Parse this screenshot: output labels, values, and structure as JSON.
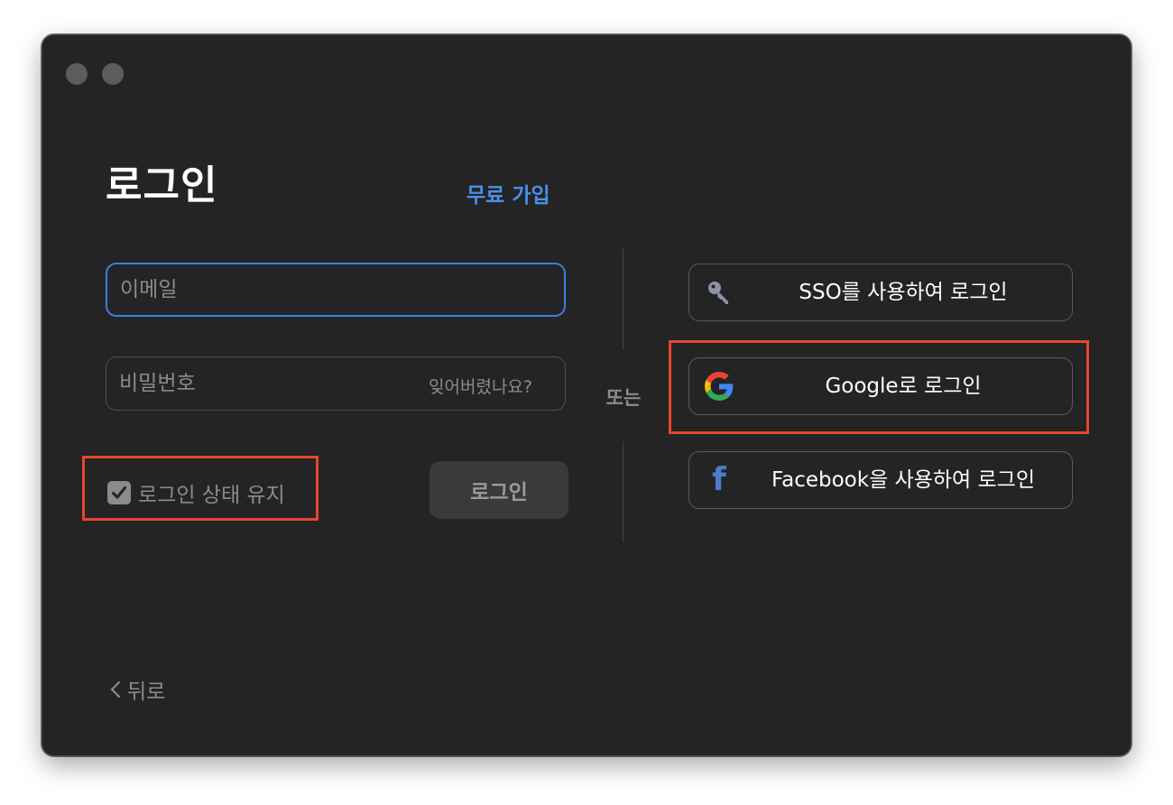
{
  "window": {
    "traffic_lights": [
      "close",
      "minimize"
    ]
  },
  "login": {
    "title": "로그인",
    "signup_link": "무료 가입",
    "email_placeholder": "이메일",
    "email_value": "",
    "password_placeholder": "비밀번호",
    "password_value": "",
    "forgot_password": "잊어버렸나요?",
    "remember_me_label": "로그인 상태 유지",
    "remember_me_checked": true,
    "login_button": "로그인"
  },
  "divider": {
    "or_label": "또는"
  },
  "social": {
    "sso": {
      "label": "SSO를 사용하여 로그인",
      "icon": "key-icon"
    },
    "google": {
      "label": "Google로 로그인",
      "icon": "google-icon"
    },
    "facebook": {
      "label": "Facebook을 사용하여 로그인",
      "icon": "facebook-icon",
      "icon_glyph": "f"
    }
  },
  "footer": {
    "back_label": "뒤로"
  },
  "colors": {
    "window_bg": "#242424",
    "accent_blue": "#4a8fec",
    "focus_border": "#3d7fe0",
    "highlight_red": "#e8452f",
    "muted_text": "#8b8b8b"
  }
}
